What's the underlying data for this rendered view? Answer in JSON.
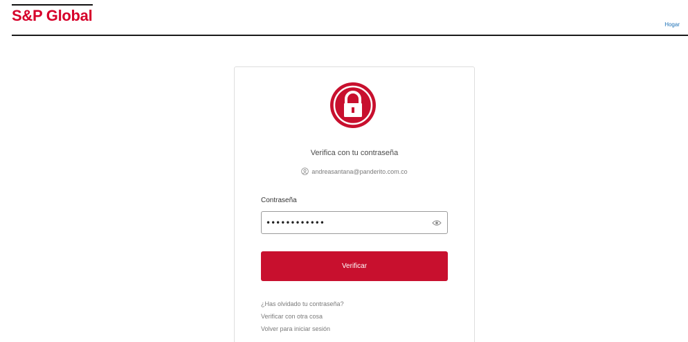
{
  "header": {
    "logo": "S&P Global",
    "help_link": "Hogar"
  },
  "card": {
    "icon": "lock-icon",
    "title": "Verifica con tu contraseña",
    "identifier_icon": "user-circle-icon",
    "identifier": "andreasantana@panderito.com.co",
    "password_label": "Contraseña",
    "password_value": "••••••••••••",
    "password_toggle_icon": "eye-icon",
    "submit_label": "Verificar",
    "links": {
      "forgot": "¿Has olvidado tu contraseña?",
      "other": "Verificar con otra cosa",
      "back": "Volver para iniciar sesión"
    }
  },
  "colors": {
    "brand_red": "#c8102e",
    "logo_red": "#d6002a",
    "link_blue": "#1a6fb5"
  }
}
